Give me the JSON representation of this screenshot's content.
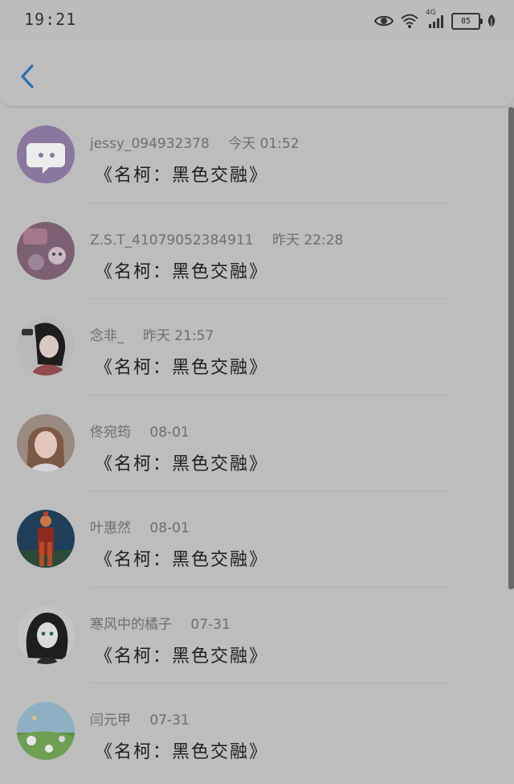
{
  "status_bar": {
    "time": "19:21",
    "network": "4G",
    "battery": "85"
  },
  "header": {
    "back_icon": "chevron-left-icon",
    "accent": "#2b6fb1"
  },
  "items": [
    {
      "name": "jessy_094932378",
      "time": "今天 01:52",
      "title": "《名柯：黑色交融》"
    },
    {
      "name": "Z.S.T_41079052384911",
      "time": "昨天 22:28",
      "title": "《名柯：黑色交融》"
    },
    {
      "name": "念非_",
      "time": "昨天 21:57",
      "title": "《名柯：黑色交融》"
    },
    {
      "name": "佟宛筠",
      "time": "08-01",
      "title": "《名柯：黑色交融》"
    },
    {
      "name": "叶惠然",
      "time": "08-01",
      "title": "《名柯：黑色交融》"
    },
    {
      "name": "寒风中的橘子",
      "time": "07-31",
      "title": "《名柯：黑色交融》"
    },
    {
      "name": "闫元甲",
      "time": "07-31",
      "title": "《名柯：黑色交融》"
    }
  ]
}
